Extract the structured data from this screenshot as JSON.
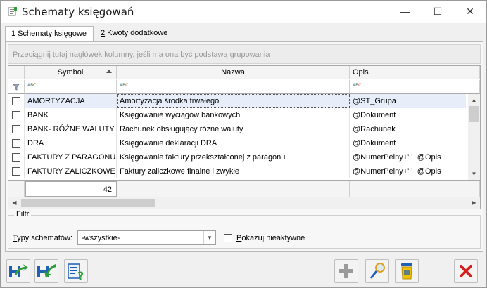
{
  "window": {
    "title": "Schematy księgowań",
    "minimize_glyph": "—",
    "maximize_glyph": "☐",
    "close_glyph": "✕"
  },
  "tabs": [
    {
      "mnemonic": "1",
      "label": " Schematy księgowe"
    },
    {
      "mnemonic": "2",
      "label": " Kwoty dodatkowe"
    }
  ],
  "group_hint": "Przeciągnij tutaj nagłówek kolumny, jeśli ma ona być podstawą grupowania",
  "grid": {
    "columns": [
      "Symbol",
      "Nazwa",
      "Opis"
    ],
    "rows": [
      {
        "symbol": "AMORTYZACJA",
        "nazwa": "Amortyzacja środka trwałego",
        "opis": "@ST_Grupa"
      },
      {
        "symbol": "BANK",
        "nazwa": "Księgowanie wyciągów bankowych",
        "opis": "@Dokument"
      },
      {
        "symbol": "BANK- RÓŻNE WALUTY",
        "nazwa": "Rachunek obsługujący różne waluty",
        "opis": "@Rachunek"
      },
      {
        "symbol": "DRA",
        "nazwa": "Księgowanie deklaracji DRA",
        "opis": "@Dokument"
      },
      {
        "symbol": "FAKTURY Z PARAGONU",
        "nazwa": "Księgowanie faktury przekształconej z paragonu",
        "opis": "@NumerPelny+' '+@Opis"
      },
      {
        "symbol": "FAKTURY ZALICZKOWE",
        "nazwa": "Faktury zaliczkowe finalne i zwykłe",
        "opis": "@NumerPelny+' '+@Opis"
      }
    ],
    "count": "42"
  },
  "filtr": {
    "legend": "Filtr",
    "typy_mnemonic": "T",
    "typy_label": "ypy schematów:",
    "typy_value": "-wszystkie-",
    "pokazuj_mnemonic": "P",
    "pokazuj_label": "okazuj nieaktywne"
  },
  "colors": {
    "accent_blue": "#1f5fb8",
    "icon_green": "#2e9e3a",
    "delete_red": "#d62020",
    "bin_yellow": "#f2c200"
  }
}
